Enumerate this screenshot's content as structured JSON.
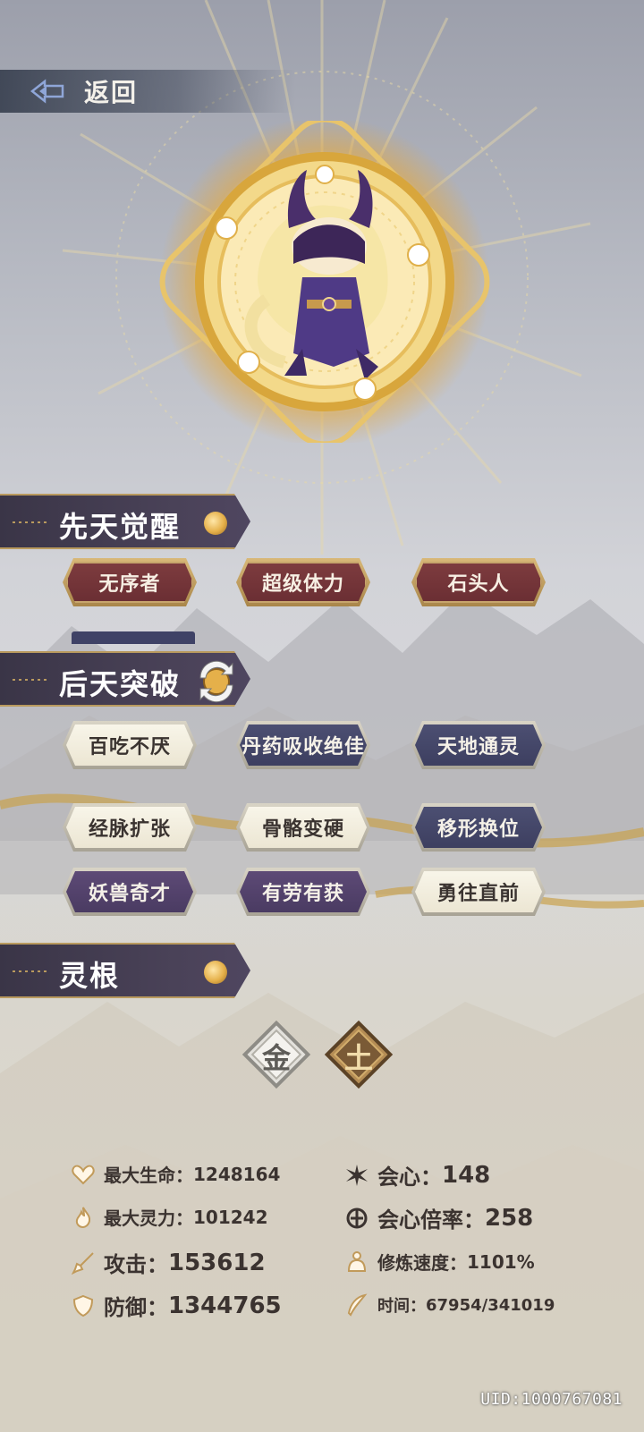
{
  "nav": {
    "back_label": "返回"
  },
  "sections": {
    "innate": {
      "title": "先天觉醒",
      "tags": [
        "无序者",
        "超级体力",
        "石头人"
      ]
    },
    "acquired": {
      "title": "后天突破",
      "tags": [
        {
          "label": "百吃不厌",
          "style": "cream"
        },
        {
          "label": "丹药吸收绝佳",
          "style": "navy"
        },
        {
          "label": "天地通灵",
          "style": "navy"
        },
        {
          "label": "经脉扩张",
          "style": "cream"
        },
        {
          "label": "骨骼变硬",
          "style": "cream"
        },
        {
          "label": "移形换位",
          "style": "navy"
        },
        {
          "label": "妖兽奇才",
          "style": "purple"
        },
        {
          "label": "有劳有获",
          "style": "purple"
        },
        {
          "label": "勇往直前",
          "style": "cream"
        }
      ]
    },
    "spirit_root": {
      "title": "灵根",
      "elements": [
        {
          "char": "金",
          "style": "silver"
        },
        {
          "char": "土",
          "style": "brown"
        }
      ]
    }
  },
  "stats": {
    "max_hp": {
      "label": "最大生命：",
      "value": "1248164"
    },
    "crit": {
      "label": "会心：",
      "value": "148"
    },
    "max_mp": {
      "label": "最大灵力：",
      "value": "101242"
    },
    "crit_rate": {
      "label": "会心倍率：",
      "value": "258"
    },
    "attack": {
      "label": "攻击：",
      "value": "153612"
    },
    "cultivation_speed": {
      "label": "修炼速度：",
      "value": "1101%"
    },
    "defense": {
      "label": "防御：",
      "value": "1344765"
    },
    "time": {
      "label": "时间：",
      "value": "67954/341019"
    }
  },
  "uid": "UID:1000767081",
  "colors": {
    "gold": "#b99a5e",
    "banner": "#3a3547",
    "red_tag": "#6a2e33",
    "navy_tag": "#3d3f60",
    "purple_tag": "#4a3b62",
    "cream_tag": "#f0ebd9"
  }
}
